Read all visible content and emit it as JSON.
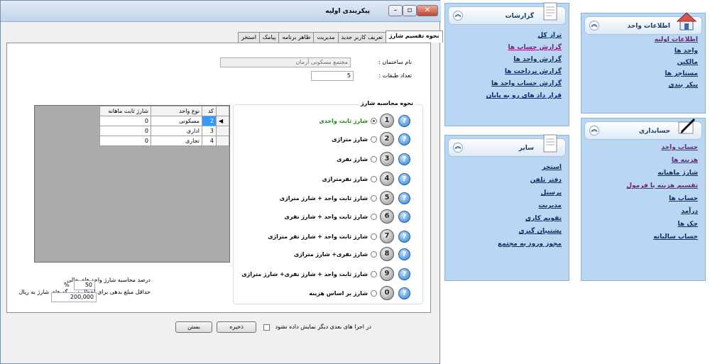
{
  "dialog": {
    "title": "پیکربندی اولیه",
    "tabs": [
      {
        "label": "نحوه تقسیم شارژ",
        "active": true
      },
      {
        "label": "تعریف کاربر جدید"
      },
      {
        "label": "مدیریت"
      },
      {
        "label": "ظاهر برنامه"
      },
      {
        "label": "پیامک"
      },
      {
        "label": "استخر"
      }
    ],
    "building_name_label": "نام ساختمان :",
    "building_name_value": "مجتمع مسکونی آرمان",
    "floors_label": "تعداد طبقات :",
    "floors_value": "5",
    "grid": {
      "columns": [
        "کد",
        "نوع واحد",
        "شارژ ثابت ماهانه"
      ],
      "rows": [
        {
          "code": "2",
          "type": "مسکونی",
          "fixed": "0"
        },
        {
          "code": "3",
          "type": "اداری",
          "fixed": "0"
        },
        {
          "code": "4",
          "type": "تجاری",
          "fixed": "0"
        }
      ]
    },
    "calc_group_title": "نحوه محاسبه شارژ",
    "options": [
      {
        "num": "1",
        "label": "شارژ ثابت واحدی",
        "selected": true
      },
      {
        "num": "2",
        "label": "شارژ متراژی"
      },
      {
        "num": "3",
        "label": "شارژ نفری"
      },
      {
        "num": "4",
        "label": "شارژ نفرمتراژی"
      },
      {
        "num": "5",
        "label": "شارژ ثابت واحد + شارژ متراژی"
      },
      {
        "num": "6",
        "label": "شارژ ثابت واحد + شارژ نفری"
      },
      {
        "num": "7",
        "label": "شارژ ثابت واحد + شارژ نفر متراژی"
      },
      {
        "num": "8",
        "label": "شارژ نفری+ شارژ متراژی"
      },
      {
        "num": "9",
        "label": "شارژ ثابت واحد + شارژ نفری+ شارژ متراژی"
      },
      {
        "num": "0",
        "label": "شارژ بر اساس هزینه"
      }
    ],
    "vacant_label": "درصد محاسبه شارژ واحد های خالی",
    "vacant_value": "50",
    "vacant_unit": "%",
    "min_debt_label": "حداقل مبلغ بدهی برای اخطار در برگه های شارژ به ریال",
    "min_debt_value": "200,000",
    "dont_show_label": "در اجرا های بعدی دیگر نمایش داده نشود",
    "save_label": "ذخیره",
    "close_label": "بستن",
    "help_glyph": "?"
  },
  "reports_panel": {
    "title": "گزارشات",
    "items": [
      "تراز کل",
      "گزارش حساب ها",
      "گزارش واحد ها",
      "گزارش پرداخت ها",
      "گزارش حساب واحد ها",
      "قرار داد های رو به پایان"
    ]
  },
  "other_panel": {
    "title": "سایر",
    "items": [
      "استخر",
      "دفتر تلفن",
      "پرسنل",
      "مدیریت",
      "تقویم کاری",
      "پشتیبان گیری",
      "مجوز ورود به مجتمع"
    ]
  },
  "unit_info_panel": {
    "title": "اطلاعات واحد",
    "items": [
      "اطلاعات اولیه",
      "واحد ها",
      "مالکین",
      "مستاجر ها",
      "پیکر بندی"
    ]
  },
  "accounting_panel": {
    "title": "حسابداری",
    "items": [
      "حساب واحد",
      "هزینه ها",
      "شارژ ماهیانه",
      "تقسیم هزینه با فرمول",
      "حساب ها",
      "درآمد",
      "چک ها",
      "حساب سالیانه"
    ]
  },
  "colors": {
    "link": "#0b2d6b",
    "visited_link": "#7a1b7a",
    "panel_bg": "#b9d6f2",
    "selected_cell": "#3399ff"
  }
}
